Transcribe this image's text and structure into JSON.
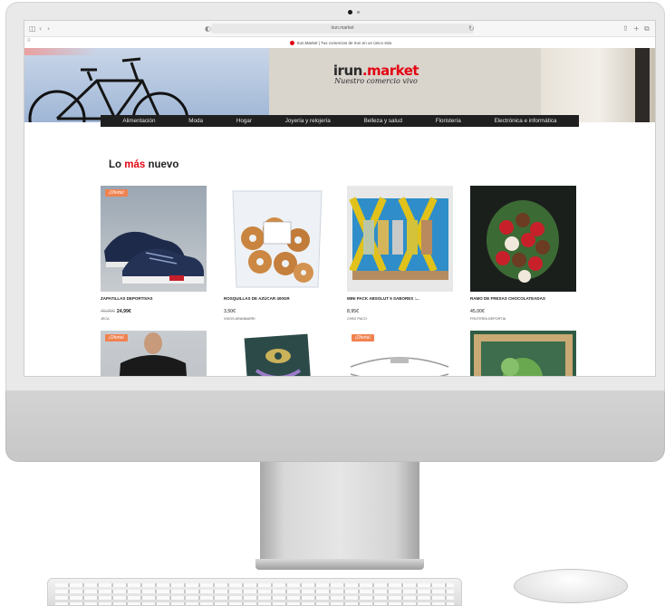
{
  "browser": {
    "address": "irun.market"
  },
  "notice": "Irun.Market | Tus comercios de Irun en un único sitio",
  "logo": {
    "brand": "irun",
    "dot": ".",
    "market": "market",
    "tagline": "Nuestro comercio vivo"
  },
  "nav": {
    "items": [
      "Alimentación",
      "Moda",
      "Hogar",
      "Joyería y relojería",
      "Belleza y salud",
      "Floristería",
      "Electrónica e informática"
    ]
  },
  "section": {
    "title_prefix": "Lo ",
    "title_highlight": "más",
    "title_suffix": " nuevo"
  },
  "products": [
    {
      "name": "ZAPATILLAS DEPORTIVAS",
      "old_price": "49,99€",
      "price": "24,99€",
      "vendor": "JECA",
      "badge": "¡Oferta!"
    },
    {
      "name": "ROSQUILLAS DE AZÚCAR 400GR",
      "price": "3,50€",
      "vendor": "VIKOS ARANBARRI"
    },
    {
      "name": "MINI PACK ABSOLUT 5 SABORES :...",
      "price": "8,95€",
      "vendor": "CHEZ PACO"
    },
    {
      "name": "RAMO DE FRESAS CHOCOLATEADAS",
      "price": "45,00€",
      "vendor": "FRUTERÍA DEPORTIA"
    }
  ],
  "products_row2": [
    {
      "badge": "¡Oferta!"
    },
    {},
    {
      "badge": "¡Oferta!"
    },
    {}
  ]
}
